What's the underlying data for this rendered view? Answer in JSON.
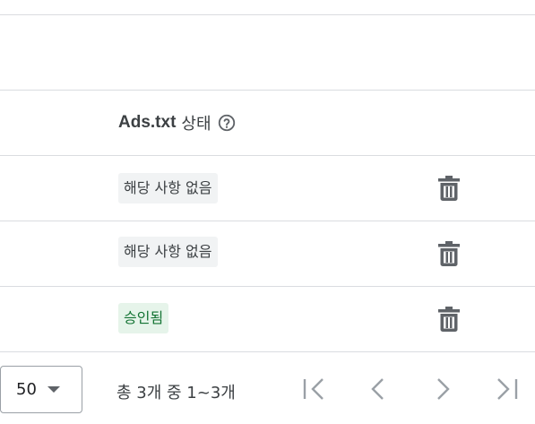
{
  "table": {
    "header": {
      "title_bold": "Ads.txt",
      "title_rest": "상태",
      "help_icon": "help-circle-icon"
    },
    "rows": [
      {
        "status": "해당 사항 없음",
        "status_kind": "neutral",
        "action_icon": "trash-icon"
      },
      {
        "status": "해당 사항 없음",
        "status_kind": "neutral",
        "action_icon": "trash-icon"
      },
      {
        "status": "승인됨",
        "status_kind": "approved",
        "action_icon": "trash-icon"
      }
    ]
  },
  "pagination": {
    "rows_per_page": "50",
    "range_text": "총 3개 중 1~3개",
    "first_icon": "first-page-icon",
    "prev_icon": "chevron-left-icon",
    "next_icon": "chevron-right-icon",
    "last_icon": "last-page-icon"
  },
  "colors": {
    "divider": "#dadce0",
    "neutral_chip_bg": "#f1f3f4",
    "approved_chip_bg": "#e6f4ea",
    "approved_text": "#137333",
    "icon": "#5f6368",
    "disabled_icon": "#9aa0a6"
  }
}
